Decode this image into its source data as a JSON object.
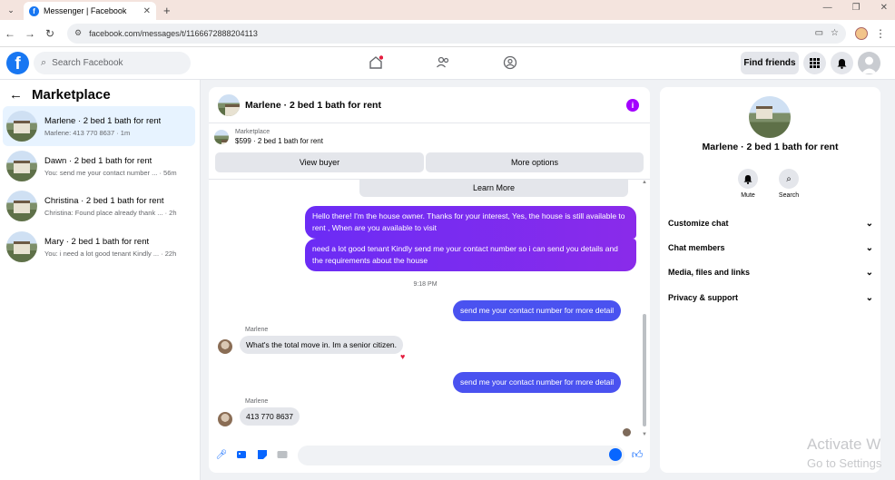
{
  "browser": {
    "tab_title": "Messenger | Facebook",
    "url": "facebook.com/messages/t/1166672888204113"
  },
  "header": {
    "search_placeholder": "Search Facebook",
    "find_friends": "Find friends"
  },
  "sidebar": {
    "title": "Marketplace",
    "conversations": [
      {
        "name": "Marlene · 2 bed 1 bath for rent",
        "preview": "Marlene: 413 770 8637 · 1m"
      },
      {
        "name": "Dawn · 2 bed 1 bath for rent",
        "preview": "You: send me your contact number ... · 56m"
      },
      {
        "name": "Christina · 2 bed 1 bath for rent",
        "preview": "Christina: Found place already thank ... · 2h"
      },
      {
        "name": "Mary · 2 bed 1 bath for rent",
        "preview": "You: i need a lot good tenant Kindly ... · 22h"
      }
    ]
  },
  "chat": {
    "title": "Marlene · 2 bed 1 bath for rent",
    "listing_source": "Marketplace",
    "listing_detail": "$599 · 2 bed 1 bath for rent",
    "view_buyer": "View buyer",
    "more_options": "More options",
    "learn_more": "Learn More",
    "msg1": "Hello there! I'm the house owner. Thanks for your interest, Yes, the house is still available to rent , When are you available to visit",
    "msg2": "need a lot good tenant Kindly send me your contact number so i can send you details and the requirements about the house",
    "time": "9:18 PM",
    "msg3": "send me your contact number for more detail",
    "sender1": "Marlene",
    "msg4": "What's the total move in. Im a senior citizen.",
    "msg5": "send me your contact number for more detail",
    "sender2": "Marlene",
    "msg6": "413 770 8637"
  },
  "details": {
    "title": "Marlene · 2 bed 1 bath for rent",
    "mute": "Mute",
    "search": "Search",
    "rows": [
      "Customize chat",
      "Chat members",
      "Media, files and links",
      "Privacy & support"
    ]
  },
  "watermark": {
    "line1": "Activate W",
    "line2": "Go to Settings"
  }
}
